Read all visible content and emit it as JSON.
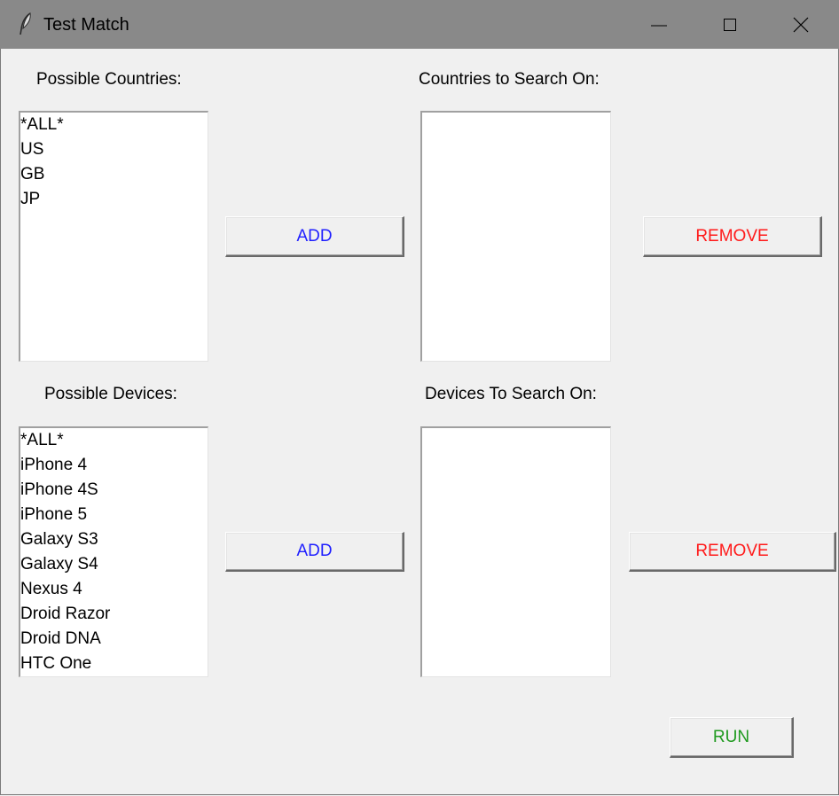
{
  "window": {
    "title": "Test Match",
    "icon": "feather-icon",
    "controls": [
      "minimize-icon",
      "maximize-icon",
      "close-icon"
    ]
  },
  "countries": {
    "possible_label": "Possible Countries:",
    "selected_label": "Countries to Search On:",
    "possible_items": [
      "*ALL*",
      "US",
      "GB",
      "JP"
    ],
    "selected_items": [],
    "add_label": "ADD",
    "remove_label": "REMOVE"
  },
  "devices": {
    "possible_label": "Possible Devices:",
    "selected_label": "Devices To Search On:",
    "possible_items": [
      "*ALL*",
      "iPhone 4",
      "iPhone 4S",
      "iPhone 5",
      "Galaxy S3",
      "Galaxy S4",
      "Nexus 4",
      "Droid Razor",
      "Droid DNA",
      "HTC One"
    ],
    "selected_items": [],
    "add_label": "ADD",
    "remove_label": "REMOVE"
  },
  "run_label": "RUN",
  "colors": {
    "titlebar": "#898989",
    "add": "#1f1fff",
    "remove": "#ff1a1a",
    "run": "#1f9a1f",
    "background": "#f0f0f0"
  }
}
